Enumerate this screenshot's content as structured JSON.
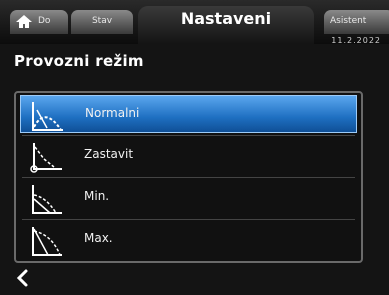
{
  "header": {
    "tabs": [
      {
        "label": "Do"
      },
      {
        "label": "Stav"
      },
      {
        "label": "Nastaveni"
      },
      {
        "label": "Asistent"
      }
    ],
    "date": "11.2.2022"
  },
  "page": {
    "title": "Provozni režim"
  },
  "modes": [
    {
      "label": "Normalni",
      "icon": "normal-mode-icon",
      "selected": true
    },
    {
      "label": "Zastavit",
      "icon": "stop-mode-icon",
      "selected": false
    },
    {
      "label": "Min.",
      "icon": "min-mode-icon",
      "selected": false
    },
    {
      "label": "Max.",
      "icon": "max-mode-icon",
      "selected": false
    }
  ],
  "colors": {
    "selected": "#1e6fc1",
    "background": "#141414"
  }
}
